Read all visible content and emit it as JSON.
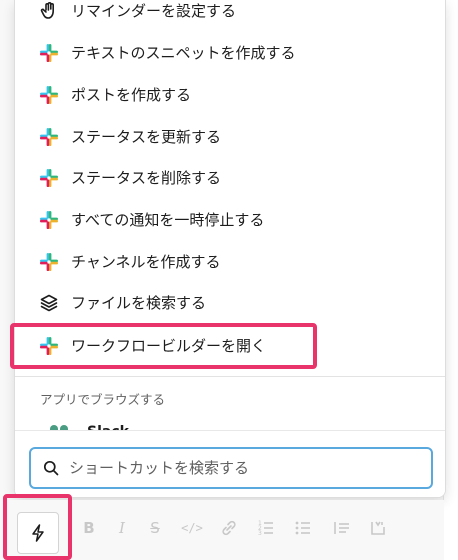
{
  "menu": {
    "items": [
      {
        "label": "リマインダーを設定する",
        "icon": "reminder-hand-icon"
      },
      {
        "label": "テキストのスニペットを作成する",
        "icon": "slack-logo-icon"
      },
      {
        "label": "ポストを作成する",
        "icon": "slack-logo-icon"
      },
      {
        "label": "ステータスを更新する",
        "icon": "slack-logo-icon"
      },
      {
        "label": "ステータスを削除する",
        "icon": "slack-logo-icon"
      },
      {
        "label": "すべての通知を一時停止する",
        "icon": "slack-logo-icon"
      },
      {
        "label": "チャンネルを作成する",
        "icon": "slack-logo-icon"
      },
      {
        "label": "ファイルを検索する",
        "icon": "layers-icon"
      },
      {
        "label": "ワークフロービルダーを開く",
        "icon": "slack-logo-icon"
      }
    ]
  },
  "apps_section": {
    "header": "アプリでブラウズする",
    "first_app": "Slack"
  },
  "search": {
    "placeholder": "ショートカットを検索する"
  },
  "composer": {
    "format_icons": [
      "bolt-icon",
      "bold-icon",
      "italic-icon",
      "strikethrough-icon",
      "code-icon",
      "link-icon",
      "ordered-list-icon",
      "bulleted-list-icon",
      "blockquote-icon"
    ]
  },
  "colors": {
    "highlight": "#e8336b",
    "search_focus": "#5aa9de",
    "slack_blue": "#36c5f0",
    "slack_green": "#2eb67d",
    "slack_yellow": "#ecb22e",
    "slack_red": "#e01e5a"
  }
}
